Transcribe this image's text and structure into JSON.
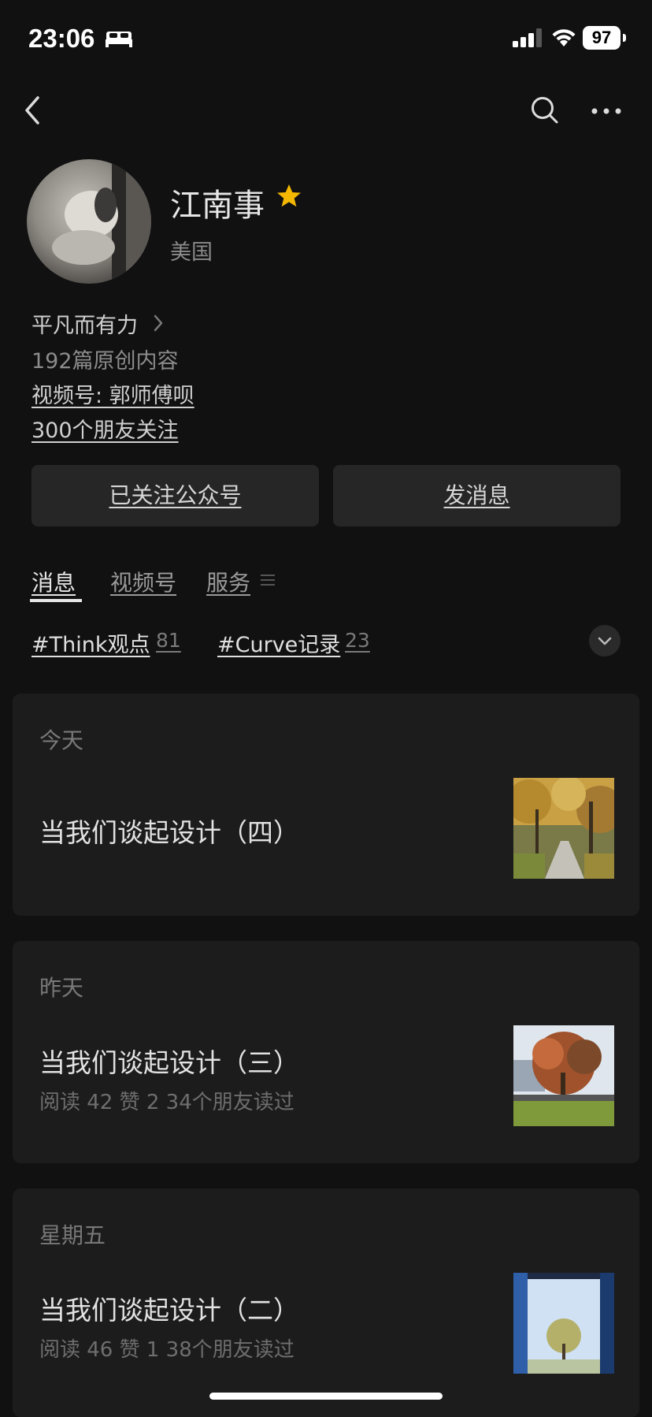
{
  "status": {
    "time": "23:06",
    "battery": "97"
  },
  "profile": {
    "name": "江南事",
    "location": "美国",
    "motto": "平凡而有力",
    "articles": "192篇原创内容",
    "video_link": "视频号: 郭师傅呗",
    "friends_link": "300个朋友关注"
  },
  "buttons": {
    "follow": "已关注公众号",
    "message": "发消息"
  },
  "tabs": [
    "消息",
    "视频号",
    "服务"
  ],
  "tags": [
    {
      "label": "#Think观点",
      "count": "81"
    },
    {
      "label": "#Curve记录",
      "count": "23"
    }
  ],
  "feed": [
    {
      "day": "今天",
      "title": "当我们谈起设计（四）",
      "meta": ""
    },
    {
      "day": "昨天",
      "title": "当我们谈起设计（三）",
      "meta": "阅读 42  赞 2  34个朋友读过"
    },
    {
      "day": "星期五",
      "title": "当我们谈起设计（二）",
      "meta": "阅读 46  赞 1  38个朋友读过"
    }
  ],
  "colors": {
    "background": "#111111",
    "card": "#1c1c1c",
    "button": "#262626",
    "star": "#f5b800"
  },
  "icons": [
    "back-icon",
    "search-icon",
    "more-icon",
    "star-icon",
    "chevron-right-icon",
    "menu-icon",
    "chevron-down-icon"
  ]
}
